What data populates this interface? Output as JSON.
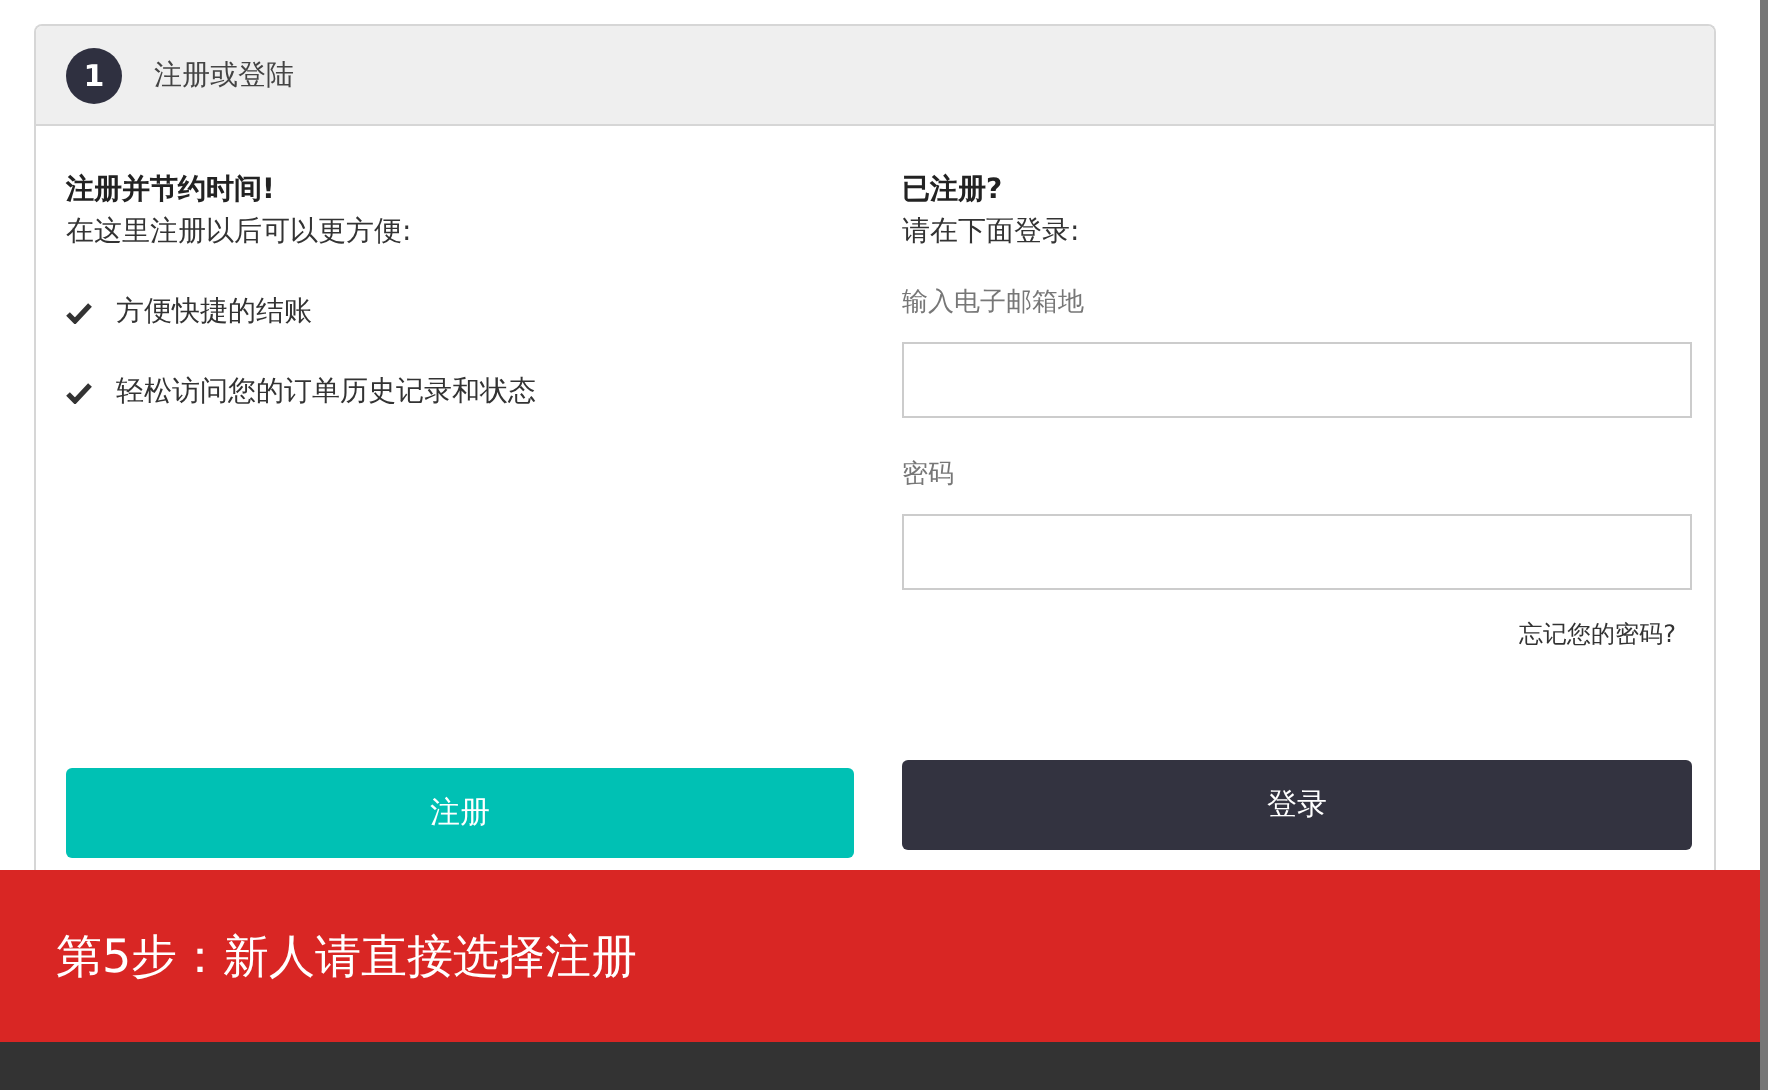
{
  "step": {
    "number": "1",
    "title": "注册或登陆"
  },
  "register": {
    "heading": "注册并节约时间!",
    "intro": "在这里注册以后可以更方便:",
    "benefits": [
      "方便快捷的结账",
      "轻松访问您的订单历史记录和状态"
    ],
    "button": "注册"
  },
  "login": {
    "heading": "已注册?",
    "intro": "请在下面登录:",
    "fields": [
      {
        "label": "输入电子邮箱地"
      },
      {
        "label": "密码"
      }
    ],
    "forgot_link": "忘记您的密码?",
    "button": "登录"
  },
  "banner": {
    "text": "第5步：新人请直接选择注册"
  }
}
